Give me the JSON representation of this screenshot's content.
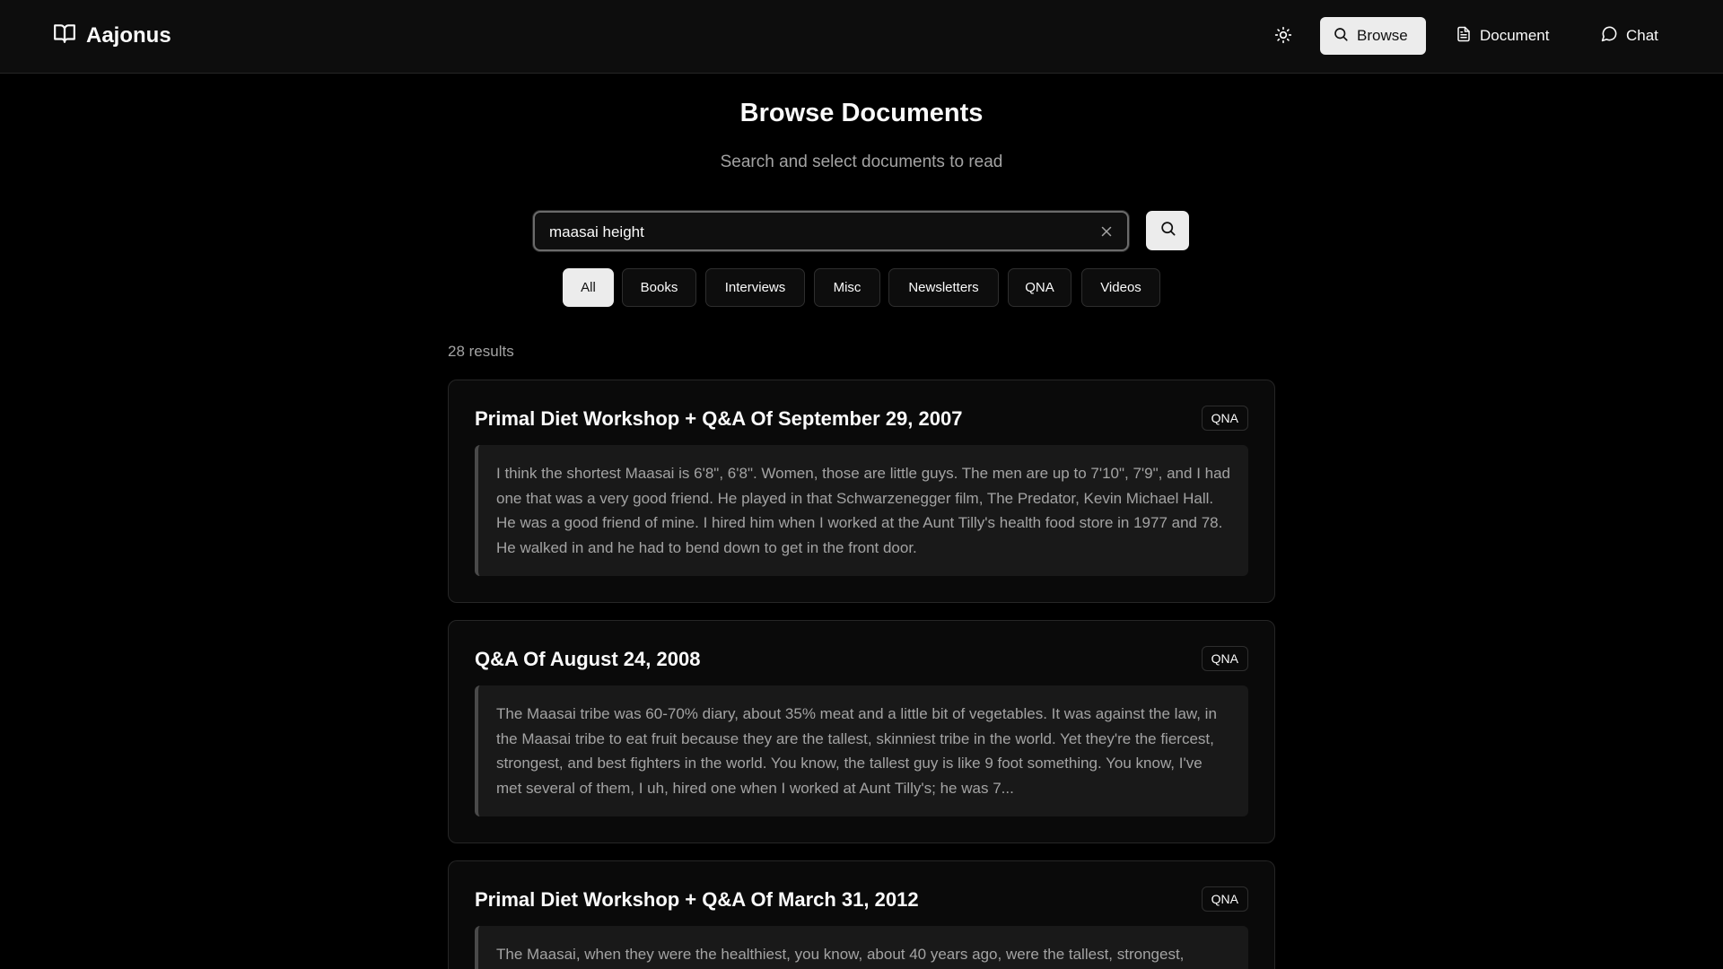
{
  "header": {
    "app_name": "Aajonus",
    "nav": [
      {
        "label": "Browse",
        "icon": "search-icon",
        "active": true
      },
      {
        "label": "Document",
        "icon": "document-icon",
        "active": false
      },
      {
        "label": "Chat",
        "icon": "chat-bubble-icon",
        "active": false
      }
    ],
    "theme_toggle_icon": "sun-icon"
  },
  "page": {
    "title": "Browse Documents",
    "subtitle": "Search and select documents to read"
  },
  "search": {
    "value": "maasai height",
    "placeholder": ""
  },
  "filters": [
    "All",
    "Books",
    "Interviews",
    "Misc",
    "Newsletters",
    "QNA",
    "Videos"
  ],
  "active_filter": "All",
  "results": {
    "count_label": "28 results",
    "items": [
      {
        "title": "Primal Diet Workshop + Q&A Of September 29, 2007",
        "badge": "QNA",
        "excerpt": "I think the shortest Maasai is 6'8\", 6'8\". Women, those are little guys. The men are up to 7'10\", 7'9\", and I had one that was a very good friend. He played in that Schwarzenegger film, The Predator, Kevin Michael Hall. He was a good friend of mine. I hired him when I worked at the Aunt Tilly's health food store in 1977 and 78. He walked in and he had to bend down to get in the front door."
      },
      {
        "title": "Q&A Of August 24, 2008",
        "badge": "QNA",
        "excerpt": "The Maasai tribe was 60-70% diary, about 35% meat and a little bit of vegetables. It was against the law, in the Maasai tribe to eat fruit because they are the tallest, skinniest tribe in the world. Yet they're the fiercest, strongest, and best fighters in the world. You know, the tallest guy is like 9 foot something. You know, I've met several of them, I uh, hired one when I worked at Aunt Tilly's; he was 7..."
      },
      {
        "title": "Primal Diet Workshop + Q&A Of March 31, 2012",
        "badge": "QNA",
        "excerpt": "The Maasai, when they were the healthiest, you know, about 40 years ago, were the tallest, strongest,"
      }
    ]
  },
  "colors": {
    "background": "#000000",
    "header_bg": "#0d0d0d",
    "accent_button": "#ececec",
    "muted_text": "#a3a3a3",
    "excerpt_bg": "#191919"
  }
}
